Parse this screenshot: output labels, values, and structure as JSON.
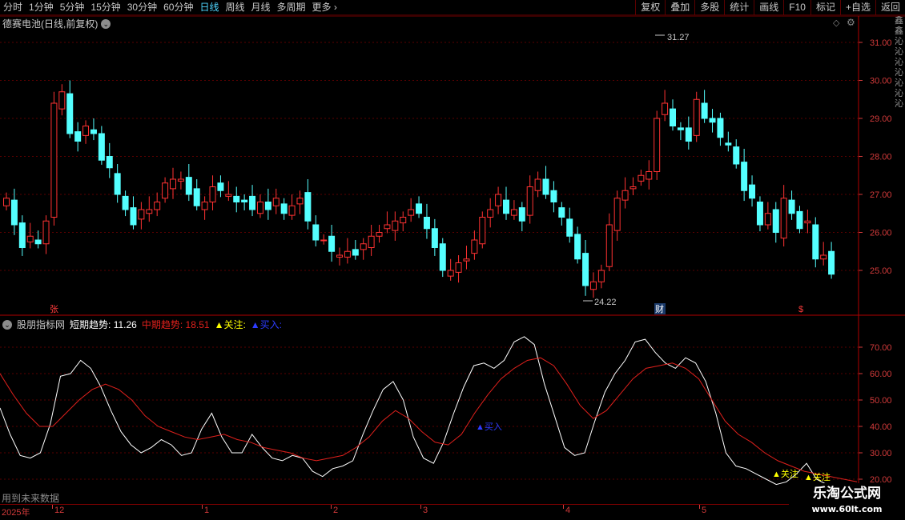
{
  "toolbar": {
    "periods": [
      "分时",
      "1分钟",
      "5分钟",
      "15分钟",
      "30分钟",
      "60分钟",
      "日线",
      "周线",
      "月线",
      "多周期",
      "更多"
    ],
    "active_period": "日线",
    "more_chevron": "›",
    "tools": [
      "复权",
      "叠加",
      "多股",
      "统计",
      "画线",
      "F10",
      "标记",
      "+自选",
      "返回"
    ]
  },
  "stock": {
    "title": "德赛电池(日线,前复权)",
    "dropdown_glyph": "⌄",
    "diamond_glyph": "◇",
    "gear_glyph": "⚙"
  },
  "price_axis": {
    "ticks": [
      "31.00",
      "30.00",
      "29.00",
      "28.00",
      "27.00",
      "26.00",
      "25.00"
    ]
  },
  "annotations": {
    "high_label": "31.27",
    "low_label": "24.22",
    "marker_zhang": "张",
    "marker_cai": "财",
    "marker_dollar": "$"
  },
  "indicator": {
    "name": "股朋指标网",
    "short_label": "短期趋势:",
    "short_value": "11.26",
    "mid_label": "中期趋势:",
    "mid_value": "18.51",
    "watch_label": "▲关注:",
    "buy_label": "▲买入:",
    "ticks": [
      "70.00",
      "60.00",
      "50.00",
      "40.00",
      "30.00",
      "20.00"
    ],
    "signal_buy": "买入",
    "signal_watch": "关注",
    "colors": {
      "short": "#ffffff",
      "mid": "#e0201c",
      "watch": "#ffff00",
      "buy": "#2d3cff"
    }
  },
  "footer": {
    "future_note": "用到未来数据",
    "year": "2025年",
    "months": [
      "12",
      "1",
      "2",
      "3",
      "4",
      "5"
    ]
  },
  "watermark": {
    "title": "乐淘公式网",
    "url": "www.60lt.com"
  },
  "right_strip": "鑫鑫沁沁沁沁沁沁沁"
}
